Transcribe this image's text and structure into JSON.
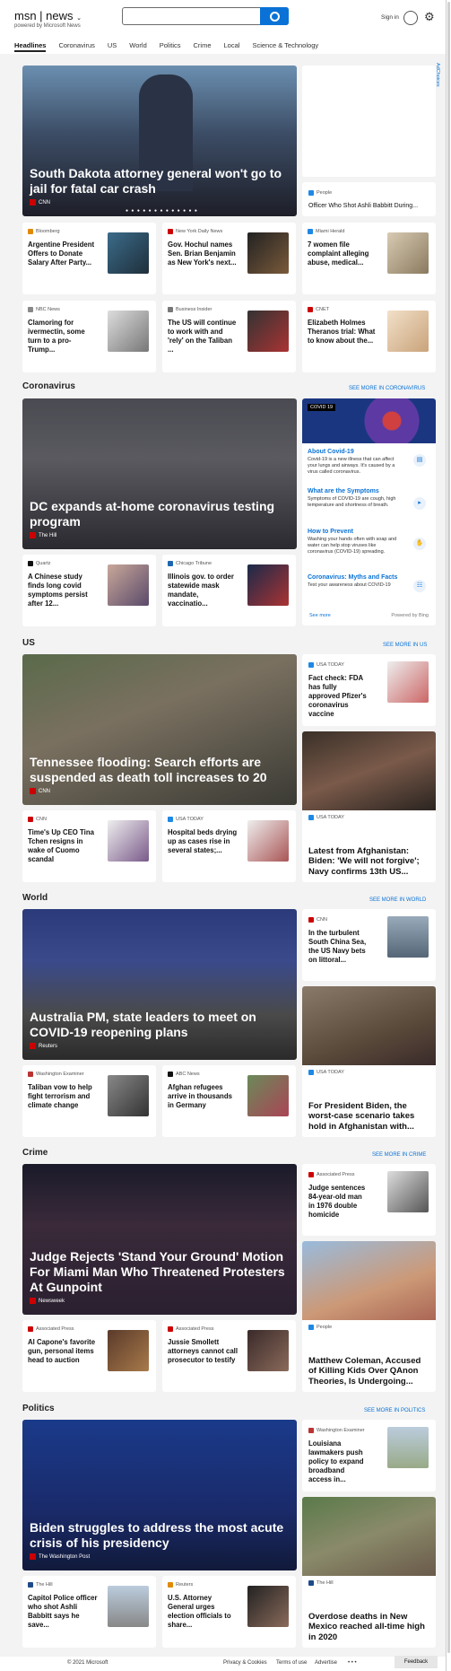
{
  "header": {
    "brand": "msn",
    "product": "news",
    "tagline": "powered by Microsoft News",
    "signin": "Sign in"
  },
  "tabs": [
    "Headlines",
    "Coronavirus",
    "US",
    "World",
    "Politics",
    "Crime",
    "Local",
    "Science & Technology"
  ],
  "ad_label": "AdChoices",
  "top": {
    "hero": {
      "title": "South Dakota attorney general won't go to jail for fatal car crash",
      "source": "CNN",
      "dots": "● ● ● ● ● ● ● ● ● ● ● ● ●"
    },
    "side": {
      "source": "People",
      "title": "Officer Who Shot Ashli Babbitt During..."
    },
    "row1": [
      {
        "source": "Bloomberg",
        "title": "Argentine President Offers to Donate Salary After Party..."
      },
      {
        "source": "New York Daily News",
        "title": "Gov. Hochul names Sen. Brian Benjamin as New York's next..."
      },
      {
        "source": "Miami Herald",
        "title": "7 women file complaint alleging abuse, medical..."
      }
    ],
    "row2": [
      {
        "source": "NBC News",
        "title": "Clamoring for ivermectin, some turn to a pro-Trump..."
      },
      {
        "source": "Business Insider",
        "title": "The US will continue to work with and 'rely' on the Taliban ..."
      },
      {
        "source": "CNET",
        "title": "Elizabeth Holmes Theranos trial: What to know about the..."
      }
    ]
  },
  "coronavirus": {
    "heading": "Coronavirus",
    "more": "SEE MORE IN CORONAVIRUS",
    "hero": {
      "title": "DC expands at-home coronavirus testing program",
      "source": "The Hill"
    },
    "cards": [
      {
        "source": "Quartz",
        "title": "A Chinese study finds long covid symptoms persist after 12..."
      },
      {
        "source": "Chicago Tribune",
        "title": "Illinois gov. to order statewide mask mandate, vaccinatio..."
      }
    ],
    "panel": {
      "badge": "COVID 19",
      "items": [
        {
          "h": "About Covid-19",
          "d": "Covid-19 is a new illness that can affect your lungs and airways. It's caused by a virus called coronavirus."
        },
        {
          "h": "What are the Symptoms",
          "d": "Symptoms of COVID-19 are cough, high temperature and shortness of breath."
        },
        {
          "h": "How to Prevent",
          "d": "Washing your hands often with soap and water can help stop viruses like coronavirus (COVID-19) spreading."
        },
        {
          "h": "Coronavirus: Myths and Facts",
          "d": "Test your awareness about COVID-19"
        }
      ],
      "see_more": "See more",
      "powered": "Powered by Bing"
    }
  },
  "us": {
    "heading": "US",
    "more": "SEE MORE IN US",
    "hero": {
      "title": "Tennessee flooding: Search efforts are suspended as death toll increases to 20",
      "source": "CNN"
    },
    "side": {
      "source": "USA TODAY",
      "title": "Fact check: FDA has fully approved Pfizer's coronavirus vaccine"
    },
    "cards": [
      {
        "source": "CNN",
        "title": "Time's Up CEO Tina Tchen resigns in wake of Cuomo scandal"
      },
      {
        "source": "USA TODAY",
        "title": "Hospital beds drying up as cases rise in several states;..."
      }
    ],
    "sideimg": {
      "source": "USA TODAY",
      "title": "Latest from Afghanistan: Biden: 'We will not forgive'; Navy confirms 13th US..."
    }
  },
  "world": {
    "heading": "World",
    "more": "SEE MORE IN WORLD",
    "hero": {
      "title": "Australia PM, state leaders to meet on COVID-19 reopening plans",
      "source": "Reuters"
    },
    "side": {
      "source": "CNN",
      "title": "In the turbulent South China Sea, the US Navy bets on littoral..."
    },
    "cards": [
      {
        "source": "Washington Examiner",
        "title": "Taliban vow to help fight terrorism and climate change"
      },
      {
        "source": "ABC News",
        "title": "Afghan refugees arrive in thousands in Germany"
      }
    ],
    "sideimg": {
      "source": "USA TODAY",
      "title": "For President Biden, the worst-case scenario takes hold in Afghanistan with..."
    }
  },
  "crime": {
    "heading": "Crime",
    "more": "SEE MORE IN CRIME",
    "hero": {
      "title": "Judge Rejects 'Stand Your Ground' Motion For Miami Man Who Threatened Protesters At Gunpoint",
      "source": "Newsweek"
    },
    "side": {
      "source": "Associated Press",
      "title": "Judge sentences 84-year-old man in 1976 double homicide"
    },
    "cards": [
      {
        "source": "Associated Press",
        "title": "Al Capone's favorite gun, personal items head to auction"
      },
      {
        "source": "Associated Press",
        "title": "Jussie Smollett attorneys cannot call prosecutor to testify"
      }
    ],
    "sideimg": {
      "source": "People",
      "title": "Matthew Coleman, Accused of Killing Kids Over QAnon Theories, Is Undergoing..."
    }
  },
  "politics": {
    "heading": "Politics",
    "more": "SEE MORE IN POLITICS",
    "hero": {
      "title": "Biden struggles to address the most acute crisis of his presidency",
      "source": "The Washington Post"
    },
    "side": {
      "source": "Washington Examiner",
      "title": "Louisiana lawmakers push policy to expand broadband access in..."
    },
    "cards": [
      {
        "source": "The Hill",
        "title": "Capitol Police officer who shot Ashli Babbitt says he save..."
      },
      {
        "source": "Reuters",
        "title": "U.S. Attorney General urges election officials to share..."
      }
    ],
    "sideimg": {
      "source": "The Hill",
      "title": "Overdose deaths in New Mexico reached all-time high in 2020"
    }
  },
  "footer": {
    "copyright": "© 2021 Microsoft",
    "privacy": "Privacy & Cookies",
    "terms": "Terms of use",
    "advertise": "Advertise",
    "more": "• • •",
    "feedback": "Feedback"
  }
}
